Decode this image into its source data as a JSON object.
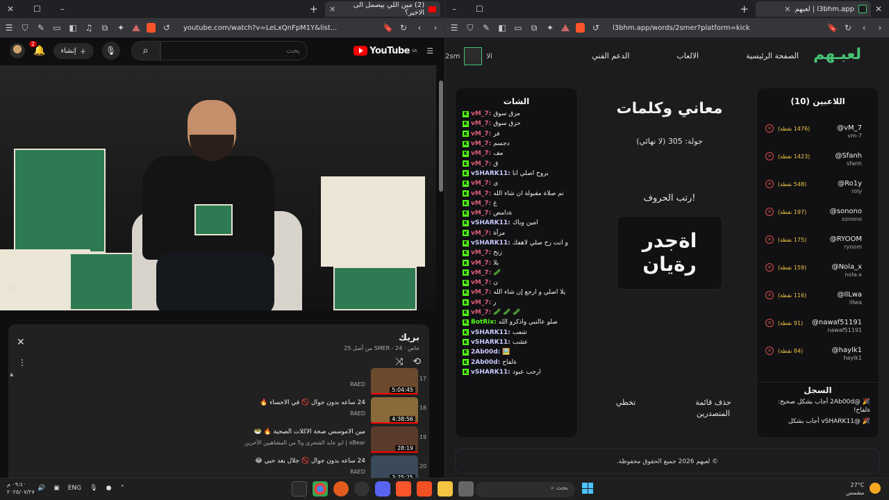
{
  "left_window": {
    "tab_title": "(2) مين اللي بيصمل الى الاخير؟",
    "url": "youtube.com/watch?v=LeLxQnFpM1Y&list...",
    "youtube": {
      "logo": "YouTube",
      "region": "SA",
      "search_placeholder": "بحث",
      "create_label": "إنشاء",
      "notif_count": "2",
      "playlist": {
        "title": "بريك",
        "subtitle": "خاص · SMER - 24 من أصل 25",
        "items": [
          {
            "num": "17",
            "title": "",
            "channel": "RAED",
            "duration": "5:04:45",
            "color": "#6b4a2e"
          },
          {
            "num": "18",
            "title": "24 ساعه بدون جوال 🚫 في الاحساء 🔥",
            "channel": "RAED",
            "duration": "4:38:56",
            "color": "#8a6a3a"
          },
          {
            "num": "19",
            "title": "مين الاموسس صحة الاكلات الصحية 🔥 🥗",
            "channel": "xBear | ابو عابد الشحري و5 من المشاهيين الآخرين",
            "duration": "28:19",
            "color": "#5a3a2a"
          },
          {
            "num": "20",
            "title": "24 ساعه بدون جوال 🚫 جلال بعد حبي 😂",
            "channel": "RAED",
            "duration": "3:25:25",
            "color": "#3b4a5a"
          }
        ]
      }
    }
  },
  "right_window": {
    "tab_title": "l3bhm.app | لعبهم",
    "url": "l3bhm.app/words/2smer?platform=kick",
    "site": {
      "logo": "لعبـهم",
      "nav": [
        "الصفحة الرئيسية",
        "الالعاب",
        "الدعم الفني"
      ],
      "nav_cut": "الا",
      "user": "2sm",
      "chat_title": "الشات",
      "chat": [
        {
          "u": "vM_7:",
          "m": "مزق سوق",
          "c": "#e05e7a"
        },
        {
          "u": "vM_7:",
          "m": "حزق سوق",
          "c": "#e05e7a"
        },
        {
          "u": "vM_7:",
          "m": "فر",
          "c": "#e05e7a"
        },
        {
          "u": "vM_7:",
          "m": "دجسم",
          "c": "#e05e7a"
        },
        {
          "u": "vM_7:",
          "m": "مف",
          "c": "#e05e7a"
        },
        {
          "u": "vM_7:",
          "m": "ق",
          "c": "#e05e7a"
        },
        {
          "u": "vSHARK11:",
          "m": "بروح اصلي انا",
          "c": "#c8c8ff"
        },
        {
          "u": "vM_7:",
          "m": "ي",
          "c": "#e05e7a"
        },
        {
          "u": "vM_7:",
          "m": "تم صلاة مقبولة ان شاء الله",
          "c": "#e05e7a"
        },
        {
          "u": "vM_7:",
          "m": "غ",
          "c": "#e05e7a"
        },
        {
          "u": "vM_7:",
          "m": "ةدامض",
          "c": "#e05e7a"
        },
        {
          "u": "vSHARK11:",
          "m": "امين وياك",
          "c": "#c8c8ff"
        },
        {
          "u": "vM_7:",
          "m": "مرآة",
          "c": "#e05e7a"
        },
        {
          "u": "vSHARK11:",
          "m": "و انت رح صلي لاهفك",
          "c": "#c8c8ff"
        },
        {
          "u": "vM_7:",
          "m": "زنخ",
          "c": "#e05e7a"
        },
        {
          "u": "vM_7:",
          "m": "يلا",
          "c": "#e05e7a"
        },
        {
          "u": "vM_7:",
          "m": "🥒",
          "c": "#e05e7a"
        },
        {
          "u": "vM_7:",
          "m": "ن",
          "c": "#e05e7a"
        },
        {
          "u": "vM_7:",
          "m": "يلا اصلي و ارجع إن شاء الله",
          "c": "#e05e7a"
        },
        {
          "u": "vM_7:",
          "m": "ر",
          "c": "#e05e7a"
        },
        {
          "u": "vM_7:",
          "m": "🥒 🥒 🥒",
          "c": "#e05e7a"
        },
        {
          "u": "BotRix:",
          "m": "صلو عالنبي واذكرو الله",
          "c": "#53fc18"
        },
        {
          "u": "vSHARK11:",
          "m": "شعب",
          "c": "#c8c8ff"
        },
        {
          "u": "vSHARK11:",
          "m": "عشب",
          "c": "#c8c8ff"
        },
        {
          "u": "2Ab00d:",
          "m": "🖼️",
          "c": "#c8c8ff"
        },
        {
          "u": "2Ab00d:",
          "m": "ةلفاح",
          "c": "#c8c8ff"
        },
        {
          "u": "vSHARK11:",
          "m": "ارحب عبود",
          "c": "#c8c8ff"
        }
      ],
      "game": {
        "title": "معاني وكلمات",
        "round": "جولة: 305 (لا نهائي)",
        "prompt": "رتب الحروف!",
        "letters_line1": "اةجدر",
        "letters_line2": "رةيان",
        "actions": [
          "حذف قائمة المتصدرين",
          "تخطي"
        ]
      },
      "players_title": "اللاعبين (10)",
      "players": [
        {
          "name": "@vM_7",
          "user": "vm-7",
          "points": "(1476 نقطة)"
        },
        {
          "name": "@Sfanh",
          "user": "sfanh",
          "points": "(1423 نقطة)"
        },
        {
          "name": "@Ro1y",
          "user": "roly",
          "points": "(548 نقطة)"
        },
        {
          "name": "@sonono",
          "user": "sonono",
          "points": "(197 نقطة)"
        },
        {
          "name": "@RYOOM",
          "user": "ryoom",
          "points": "(175 نقطة)"
        },
        {
          "name": "@Nola_x",
          "user": "nola-x",
          "points": "(159 نقطة)"
        },
        {
          "name": "@IlLwa",
          "user": "illwa",
          "points": "(116 نقطة)"
        },
        {
          "name": "@nawaf51191",
          "user": "nawaf51191",
          "points": "(91 نقطة)"
        },
        {
          "name": "@haylk1",
          "user": "haylk1",
          "points": "(84 نقطة)"
        }
      ],
      "log_title": "السجل",
      "log": [
        "🎉 @2Ab00d أجاب بشكل صحيح: ةلفاح!",
        "🎉 @vSHARK11 أجاب بشكل"
      ],
      "footer": "© لعبهم 2026 جميع الحقوق محفوظة."
    }
  },
  "taskbar": {
    "time": "٠٩:٤٠ م",
    "date": "٢٠٢٥/٠٧/٢٧",
    "lang": "ENG",
    "search": "بحث",
    "weather_temp": "27°C",
    "weather_desc": "مشمس"
  }
}
